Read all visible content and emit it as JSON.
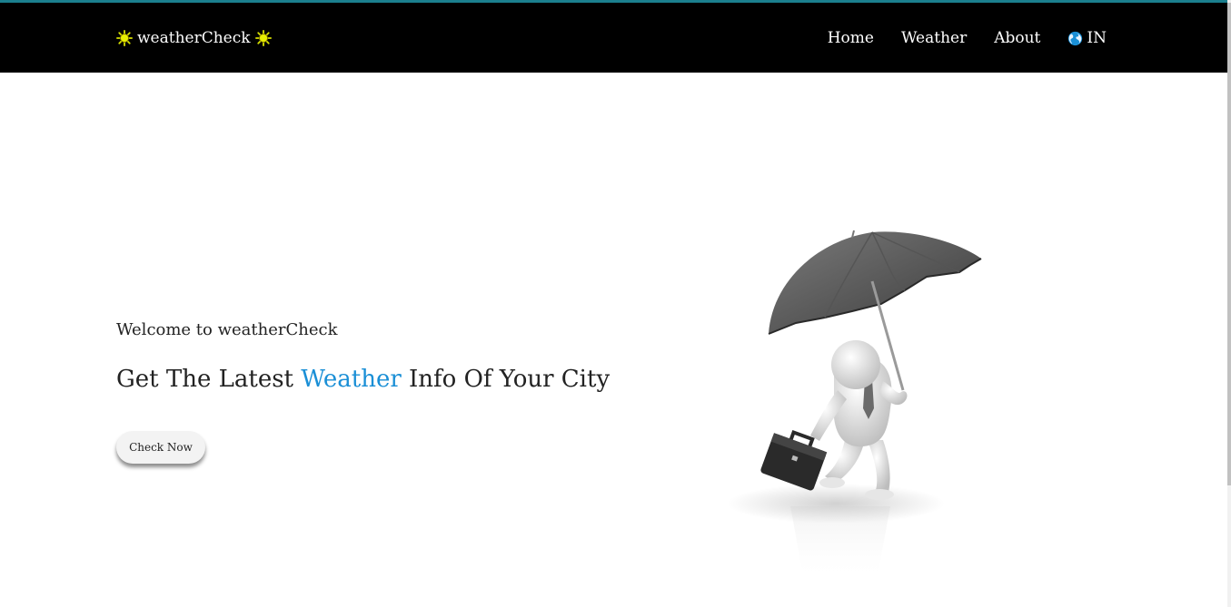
{
  "navbar": {
    "brand": "weatherCheck",
    "links": [
      {
        "label": "Home"
      },
      {
        "label": "Weather"
      },
      {
        "label": "About"
      }
    ],
    "lang_label": "IN",
    "brand_icon": "sun-icon",
    "lang_icon": "globe-icon"
  },
  "hero": {
    "welcome": "Welcome to weatherCheck",
    "headline_pre": "Get The Latest",
    "headline_accent": "Weather",
    "headline_post": "Info Of Your City",
    "cta": "Check Now",
    "illustration": "man-with-umbrella-illustration"
  },
  "colors": {
    "navbar_bg": "#000000",
    "top_accent_line": "#1b7f8e",
    "accent_text": "#1a8fd6",
    "sun_icon": "#e8f000"
  }
}
